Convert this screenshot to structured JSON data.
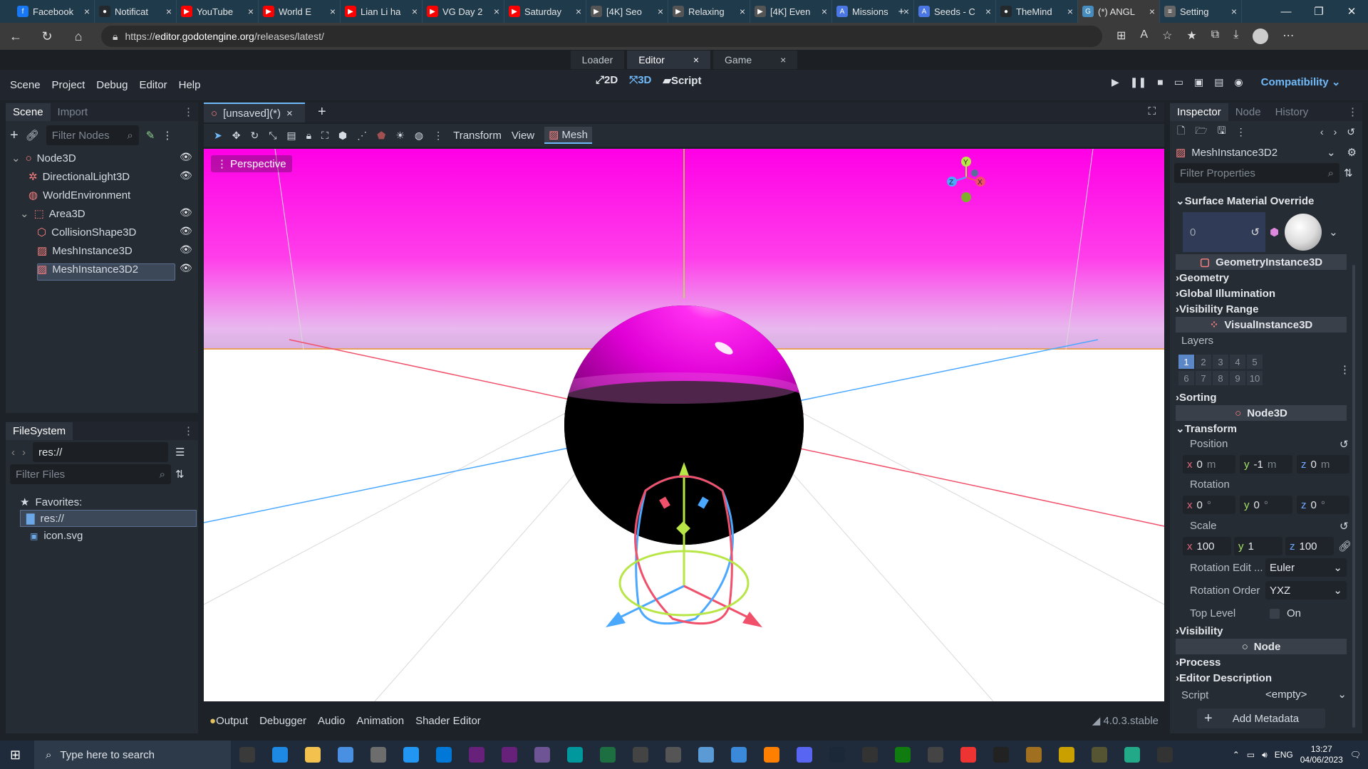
{
  "browser": {
    "tabs": [
      {
        "label": "Facebook",
        "color": "#1877f2",
        "glyph": "f"
      },
      {
        "label": "Notificat",
        "color": "#24292e",
        "glyph": "●"
      },
      {
        "label": "YouTube",
        "color": "#ff0000",
        "glyph": "▶"
      },
      {
        "label": "World E",
        "color": "#ff0000",
        "glyph": "▶"
      },
      {
        "label": "Lian Li ha",
        "color": "#ff0000",
        "glyph": "▶"
      },
      {
        "label": "VG Day 2",
        "color": "#ff0000",
        "glyph": "▶"
      },
      {
        "label": "Saturday",
        "color": "#ff0000",
        "glyph": "▶"
      },
      {
        "label": "[4K] Seo",
        "color": "#555555",
        "glyph": "▶"
      },
      {
        "label": "Relaxing",
        "color": "#555555",
        "glyph": "▶"
      },
      {
        "label": "[4K] Even",
        "color": "#555555",
        "glyph": "▶"
      },
      {
        "label": "Missions",
        "color": "#4a77e3",
        "glyph": "A"
      },
      {
        "label": "Seeds - C",
        "color": "#4a77e3",
        "glyph": "A"
      },
      {
        "label": "TheMind",
        "color": "#24292e",
        "glyph": "●"
      },
      {
        "label": "(*) ANGL",
        "color": "#478cbf",
        "glyph": "G"
      },
      {
        "label": "Setting",
        "color": "#666666",
        "glyph": "≡"
      }
    ],
    "url_prefix": "https://",
    "url_host": "editor.godotengine.org",
    "url_path": "/releases/latest/"
  },
  "godot": {
    "page_tabs": [
      "Loader",
      "Editor",
      "Game"
    ],
    "menu": [
      "Scene",
      "Project",
      "Debug",
      "Editor",
      "Help"
    ],
    "modes": [
      "2D",
      "3D",
      "Script"
    ],
    "renderer": "Compatibility",
    "scene_dock": {
      "tabs": [
        "Scene",
        "Import"
      ],
      "filter_placeholder": "Filter Nodes",
      "nodes": [
        {
          "name": "Node3D",
          "icon_color": "#fc7f7f"
        },
        {
          "name": "DirectionalLight3D",
          "icon_color": "#fc7f7f"
        },
        {
          "name": "WorldEnvironment",
          "icon_color": "#fc7f7f"
        },
        {
          "name": "Area3D",
          "icon_color": "#fc7f7f"
        },
        {
          "name": "CollisionShape3D",
          "icon_color": "#fc7f7f"
        },
        {
          "name": "MeshInstance3D",
          "icon_color": "#fc7f7f"
        },
        {
          "name": "MeshInstance3D2",
          "icon_color": "#fc7f7f"
        }
      ]
    },
    "filesystem": {
      "title": "FileSystem",
      "path": "res://",
      "filter_placeholder": "Filter Files",
      "favorites": "Favorites:",
      "root": "res://",
      "file": "icon.svg"
    },
    "editor_tab": "[unsaved](*)",
    "toolbar": {
      "transform": "Transform",
      "view": "View",
      "mesh": "Mesh"
    },
    "viewport": {
      "label": "Perspective",
      "sky_color": "#ff00e6",
      "gizmo_labels": [
        "Y",
        "X",
        "Z"
      ]
    },
    "bottom": {
      "tabs": [
        "Output",
        "Debugger",
        "Audio",
        "Animation",
        "Shader Editor"
      ],
      "version": "4.0.3.stable"
    },
    "inspector": {
      "tabs": [
        "Inspector",
        "Node",
        "History"
      ],
      "node_name": "MeshInstance3D2",
      "filter_placeholder": "Filter Properties",
      "surface_override": "Surface Material Override",
      "surface_index": "0",
      "class_geometry": "GeometryInstance3D",
      "geometry": "Geometry",
      "gi": "Global Illumination",
      "visibility_range": "Visibility Range",
      "class_visual": "VisualInstance3D",
      "layers": "Layers",
      "layer_numbers": [
        "1",
        "2",
        "3",
        "4",
        "5",
        "6",
        "7",
        "8",
        "9",
        "10"
      ],
      "sorting": "Sorting",
      "class_node3d": "Node3D",
      "transform": "Transform",
      "position": "Position",
      "position_values": {
        "x": "0",
        "y": "-1",
        "z": "0",
        "unit": "m"
      },
      "rotation": "Rotation",
      "rotation_values": {
        "x": "0",
        "y": "0",
        "z": "0",
        "unit": "°"
      },
      "scale": "Scale",
      "scale_values": {
        "x": "100",
        "y": "1",
        "z": "100"
      },
      "rotation_edit_label": "Rotation Edit ...",
      "rotation_edit_value": "Euler",
      "rotation_order_label": "Rotation Order",
      "rotation_order_value": "YXZ",
      "top_level": "Top Level",
      "top_level_value": "On",
      "visibility": "Visibility",
      "class_node": "Node",
      "process": "Process",
      "editor_description": "Editor Description",
      "script_label": "Script",
      "script_value": "<empty>",
      "add_metadata": "Add Metadata"
    }
  },
  "taskbar": {
    "search_placeholder": "Type here to search",
    "lang": "ENG",
    "time": "13:27",
    "date": "04/06/2023"
  }
}
